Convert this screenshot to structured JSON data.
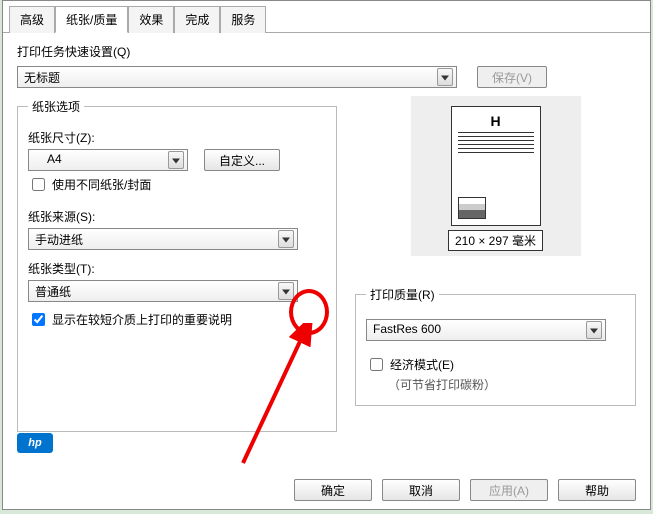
{
  "tabs": {
    "t0": "高级",
    "t1": "纸张/质量",
    "t2": "效果",
    "t3": "完成",
    "t4": "服务"
  },
  "quickset": {
    "label": "打印任务快速设置(Q)",
    "value": "无标题",
    "save": "保存(V)"
  },
  "paper_options": {
    "legend": "纸张选项",
    "size_label": "纸张尺寸(Z):",
    "size_value": "A4",
    "custom_btn": "自定义...",
    "diff_cover": "使用不同纸张/封面",
    "source_label": "纸张来源(S):",
    "source_value": "手动进纸",
    "type_label": "纸张类型(T):",
    "type_value": "普通纸",
    "important_note": "显示在较短介质上打印的重要说明"
  },
  "preview": {
    "dim": "210 × 297 毫米"
  },
  "quality": {
    "legend": "打印质量(R)",
    "value": "FastRes 600",
    "econ": "经济模式(E)",
    "econ_sub": "（可节省打印碳粉）"
  },
  "footer": {
    "ok": "确定",
    "cancel": "取消",
    "apply": "应用(A)",
    "help": "帮助"
  },
  "logo": "hp"
}
